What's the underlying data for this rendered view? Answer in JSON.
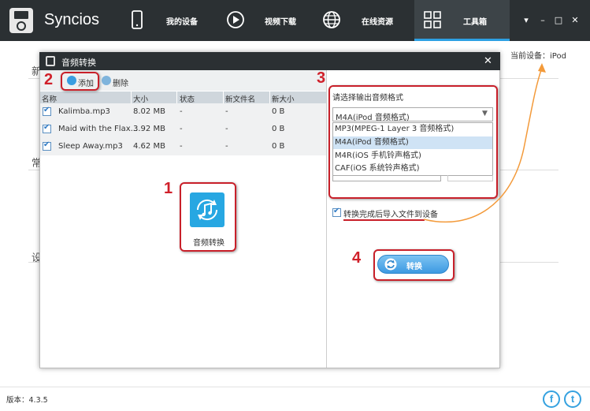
{
  "app": {
    "title": "Syncios"
  },
  "nav": {
    "my_device": "我的设备",
    "video_download": "视频下载",
    "online_resources": "在线资源",
    "toolbox": "工具箱"
  },
  "window_controls": {
    "menu": "▾",
    "minimize": "–",
    "maximize": "□",
    "close": "✕"
  },
  "main": {
    "current_device": "当前设备：iPod",
    "section_letters": [
      "新",
      "常",
      "设"
    ]
  },
  "dialog": {
    "title": "音频转换",
    "close": "✕",
    "toolbar": {
      "add_label": "添加",
      "delete_label": "删除"
    },
    "table": {
      "columns": [
        "名称",
        "大小",
        "状态",
        "新文件名",
        "新大小"
      ],
      "rows": [
        {
          "checked": true,
          "name": "Kalimba.mp3",
          "size": "8.02 MB",
          "status": "-",
          "new_name": "-",
          "new_size": "0 B"
        },
        {
          "checked": true,
          "name": "Maid with the Flax...",
          "size": "3.92 MB",
          "status": "-",
          "new_name": "-",
          "new_size": "0 B"
        },
        {
          "checked": true,
          "name": "Sleep Away.mp3",
          "size": "4.62 MB",
          "status": "-",
          "new_name": "-",
          "new_size": "0 B"
        }
      ]
    },
    "convert_tool_label": "音频转换",
    "format": {
      "heading": "请选择输出音频格式",
      "selected": "M4A(iPod 音频格式)",
      "options": [
        "MP3(MPEG-1 Layer 3 音频格式)",
        "M4A(iPod 音频格式)",
        "M4R(iOS 手机铃声格式)",
        "CAF(iOS 系统铃声格式)"
      ],
      "highlighted_index": 1
    },
    "import_after_convert": {
      "checked": true,
      "label": "转换完成后导入文件到设备"
    },
    "convert_button": "转换"
  },
  "annotations": {
    "step1": "1",
    "step2": "2",
    "step3": "3",
    "step4": "4"
  },
  "footer": {
    "version": "版本：4.3.5",
    "facebook": "f",
    "twitter": "t"
  },
  "colors": {
    "titlebar": "#2b3033",
    "accent": "#2da0e3",
    "annotation_red": "#c8202a",
    "arrow_orange": "#f39a3a"
  }
}
